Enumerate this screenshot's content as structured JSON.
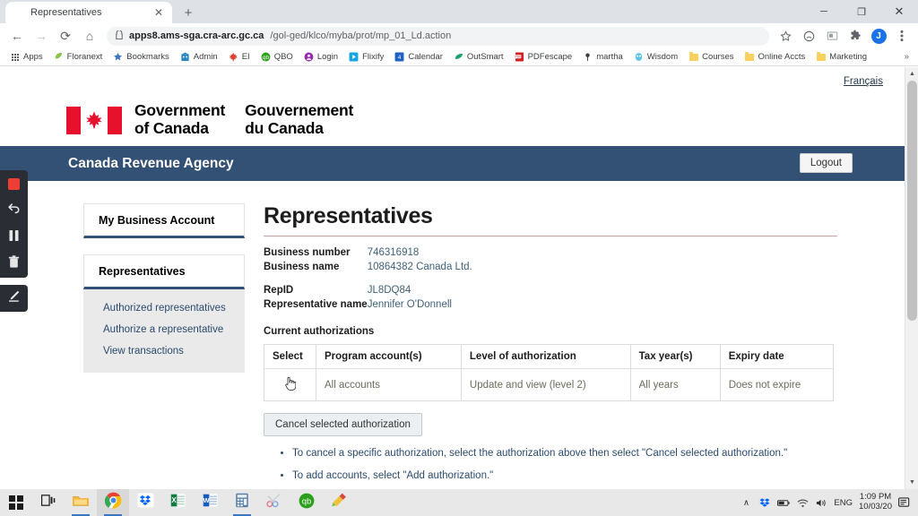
{
  "browser": {
    "tab": {
      "title": "Representatives",
      "favicon": "maple-leaf-icon",
      "close": "✕"
    },
    "new_tab_label": "+",
    "window_controls": {
      "minimize": "─",
      "maximize": "❐",
      "close": "✕"
    },
    "nav": {
      "back": "←",
      "forward": "→",
      "reload": "⟳",
      "home": "⌂"
    },
    "omnibox": {
      "lock": "🔒",
      "host": "apps8.ams-sga.cra-arc.gc.ca",
      "path": "/gol-ged/klco/myba/prot/mp_01_Ld.action",
      "full_url": "apps8.ams-sga.cra-arc.gc.ca/gol-ged/klco/myba/prot/mp_01_Ld.action"
    },
    "toolbar_icons": [
      "star-icon",
      "profile-circle-icon",
      "cast-icon",
      "extensions-puzzle-icon",
      "account-avatar",
      "kebab-menu-icon"
    ],
    "avatar_letter": "J",
    "bookmarks": [
      {
        "label": "Apps",
        "icon": "apps-grid-icon"
      },
      {
        "label": "Floranext",
        "icon": "leaf-icon"
      },
      {
        "label": "Bookmarks",
        "icon": "star-icon"
      },
      {
        "label": "Admin",
        "icon": "building-icon"
      },
      {
        "label": "EI",
        "icon": "maple-leaf-icon"
      },
      {
        "label": "QBO",
        "icon": "quickbooks-icon"
      },
      {
        "label": "Login",
        "icon": "person-circle-icon"
      },
      {
        "label": "Flixify",
        "icon": "play-square-icon"
      },
      {
        "label": "Calendar",
        "icon": "calendar-icon"
      },
      {
        "label": "OutSmart",
        "icon": "leaf-green-icon"
      },
      {
        "label": "PDFescape",
        "icon": "pdf-icon"
      },
      {
        "label": "martha",
        "icon": "pin-icon"
      },
      {
        "label": "Wisdom",
        "icon": "owl-icon"
      },
      {
        "label": "Courses",
        "icon": "folder-icon"
      },
      {
        "label": "Online Accts",
        "icon": "folder-icon"
      },
      {
        "label": "Marketing",
        "icon": "folder-icon"
      }
    ],
    "overflow_label": "»"
  },
  "page": {
    "language_link": "Français",
    "goc": {
      "english": "Government\nof Canada",
      "english_line1": "Government",
      "english_line2": "of Canada",
      "french_line1": "Gouvernement",
      "french_line2": "du Canada"
    },
    "banner": {
      "title": "Canada Revenue Agency",
      "logout": "Logout",
      "bg": "#335075"
    },
    "sidebar": {
      "box1_title": "My Business Account",
      "box2_title": "Representatives",
      "links": [
        "Authorized representatives",
        "Authorize a representative",
        "View transactions"
      ]
    },
    "main": {
      "title": "Representatives",
      "fields": [
        {
          "label": "Business number",
          "value": "746316918"
        },
        {
          "label": "Business name",
          "value": "10864382 Canada Ltd."
        },
        {
          "label": "RepID",
          "value": "JL8DQ84"
        },
        {
          "label": "Representative name",
          "value": "Jennifer O'Donnell"
        }
      ],
      "table_caption": "Current authorizations",
      "table": {
        "headers": [
          "Select",
          "Program account(s)",
          "Level of authorization",
          "Tax year(s)",
          "Expiry date"
        ],
        "rows": [
          {
            "select": "",
            "program_accounts": "All accounts",
            "level": "Update and view (level 2)",
            "tax_years": "All years",
            "expiry": "Does not expire"
          }
        ]
      },
      "cancel_button": "Cancel selected authorization",
      "hints": [
        "To cancel a specific authorization, select the authorization above then select \"Cancel selected authorization.\"",
        "To add accounts, select \"Add authorization.\""
      ]
    }
  },
  "recorder": {
    "buttons": [
      {
        "name": "record",
        "icon": "red-square-stop-icon"
      },
      {
        "name": "undo",
        "icon": "undo-arrow-icon"
      },
      {
        "name": "pause",
        "icon": "pause-icon"
      },
      {
        "name": "delete",
        "icon": "trash-icon"
      },
      {
        "name": "annotate",
        "icon": "pencil-icon"
      }
    ]
  },
  "taskbar": {
    "items": [
      {
        "name": "start",
        "icon": "windows-logo-icon"
      },
      {
        "name": "task-view",
        "icon": "task-view-icon"
      },
      {
        "name": "file-explorer",
        "icon": "folder-icon"
      },
      {
        "name": "chrome",
        "icon": "chrome-icon"
      },
      {
        "name": "dropbox",
        "icon": "dropbox-icon"
      },
      {
        "name": "excel",
        "icon": "excel-icon"
      },
      {
        "name": "word",
        "icon": "word-icon"
      },
      {
        "name": "calculator",
        "icon": "calculator-icon"
      },
      {
        "name": "snipping-tool",
        "icon": "scissors-icon"
      },
      {
        "name": "quickbooks",
        "icon": "quickbooks-icon"
      },
      {
        "name": "paint",
        "icon": "paint-icon"
      }
    ],
    "tray": {
      "chevron": "∧",
      "icons": [
        "dropbox-tray-icon",
        "battery-icon",
        "wifi-icon",
        "speaker-icon"
      ],
      "language": "ENG",
      "time": "1:09 PM",
      "date": "10/03/20",
      "action_center": "notification-icon"
    }
  }
}
